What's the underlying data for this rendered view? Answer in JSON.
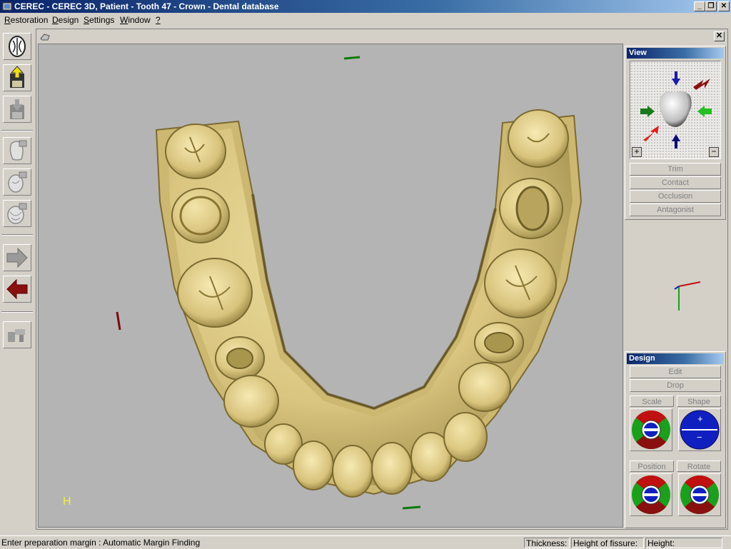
{
  "window": {
    "title": "CEREC - CEREC 3D, Patient - Tooth  47 - Crown - Dental database",
    "minimize_label": "_",
    "maximize_label": "❐",
    "close_label": "✕"
  },
  "menu": {
    "items": [
      {
        "label": "Restoration",
        "shortcut": "R"
      },
      {
        "label": "Design",
        "shortcut": "D"
      },
      {
        "label": "Settings",
        "shortcut": "S"
      },
      {
        "label": "Window",
        "shortcut": "W"
      },
      {
        "label": "?",
        "shortcut": "?"
      }
    ]
  },
  "toolbar": {
    "icons": [
      "jaw-icon",
      "load-icon",
      "save-icon",
      "scan-tooth-icon",
      "scan-antagonist-icon",
      "scan-buccal-icon",
      "next-arrow-icon",
      "back-arrow-icon",
      "mill-icon"
    ]
  },
  "child": {
    "close_label": "✕"
  },
  "viewport": {
    "corner_mark": "H"
  },
  "view_panel": {
    "title": "View",
    "zoom_in": "+",
    "zoom_out": "−",
    "buttons": [
      "Trim",
      "Contact",
      "Occlusion",
      "Antagonist"
    ]
  },
  "design_panel": {
    "title": "Design",
    "edit_label": "Edit",
    "drop_label": "Drop",
    "scale_label": "Scale",
    "shape_label": "Shape",
    "shape_plus": "+",
    "shape_minus": "−",
    "position_label": "Position",
    "rotate_label": "Rotate"
  },
  "status": {
    "prompt": "Enter preparation margin :  Automatic Margin Finding",
    "thickness_label": "Thickness:",
    "fissure_label": "Height of fissure:",
    "height_label": "Height:"
  },
  "colors": {
    "tooth": "#e3d28f",
    "tooth_shadow": "#8a7a3c",
    "viewport_bg": "#b4b4b4",
    "title_blue": "#0a246a"
  }
}
